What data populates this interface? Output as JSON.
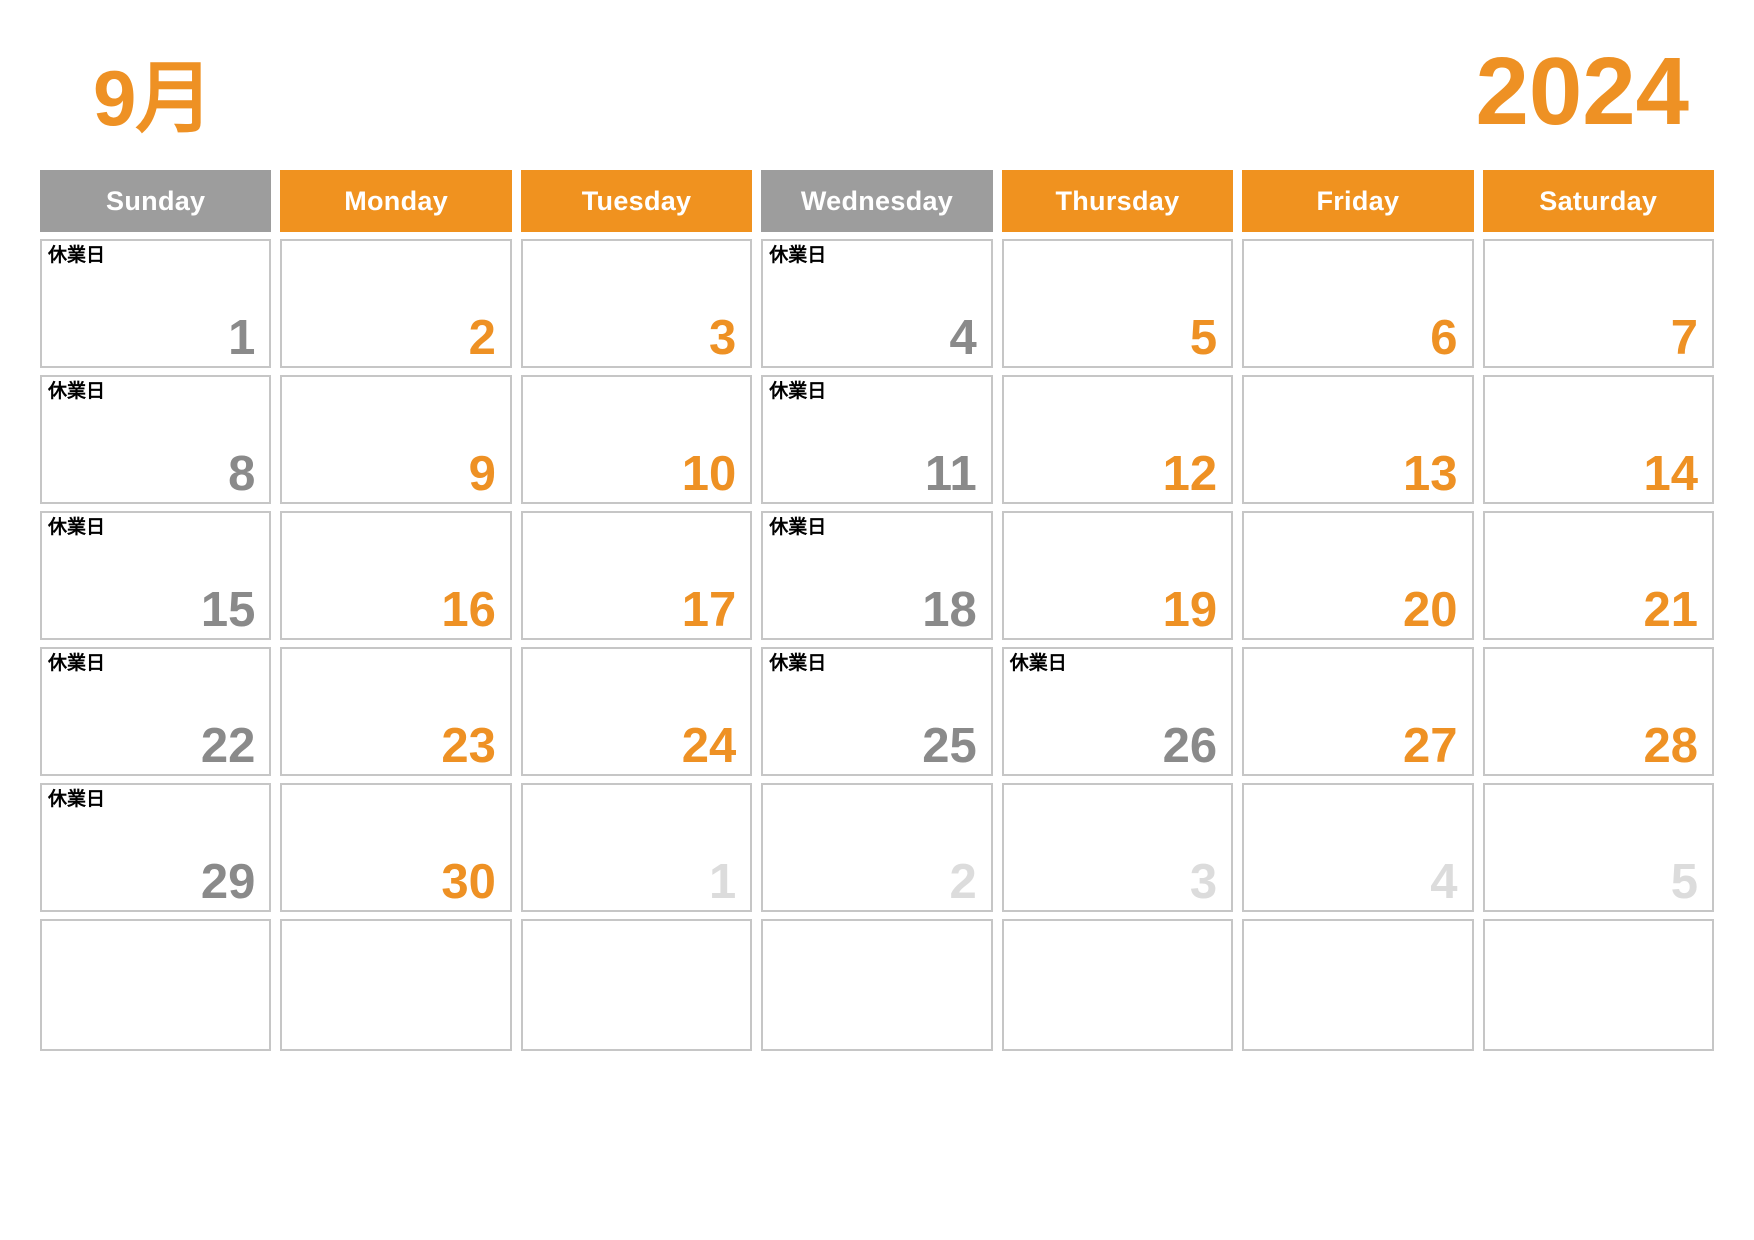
{
  "header": {
    "month_label": "9月",
    "year_label": "2024"
  },
  "colors": {
    "accent_orange": "#ee9124",
    "header_orange": "#f0921f",
    "header_gray": "#9d9d9d",
    "day_gray": "#8a8a8a",
    "muted_gray": "#dcdcdc",
    "cell_border": "#c6c6c6",
    "note_black": "#000000"
  },
  "weekday_headers": [
    {
      "label": "Sunday",
      "style": "gray"
    },
    {
      "label": "Monday",
      "style": "orange"
    },
    {
      "label": "Tuesday",
      "style": "orange"
    },
    {
      "label": "Wednesday",
      "style": "gray"
    },
    {
      "label": "Thursday",
      "style": "orange"
    },
    {
      "label": "Friday",
      "style": "orange"
    },
    {
      "label": "Saturday",
      "style": "orange"
    }
  ],
  "closed_note": "休業日",
  "weeks": [
    [
      {
        "day": "1",
        "style": "gray",
        "note": "休業日"
      },
      {
        "day": "2",
        "style": "orange",
        "note": ""
      },
      {
        "day": "3",
        "style": "orange",
        "note": ""
      },
      {
        "day": "4",
        "style": "gray",
        "note": "休業日"
      },
      {
        "day": "5",
        "style": "orange",
        "note": ""
      },
      {
        "day": "6",
        "style": "orange",
        "note": ""
      },
      {
        "day": "7",
        "style": "orange",
        "note": ""
      }
    ],
    [
      {
        "day": "8",
        "style": "gray",
        "note": "休業日"
      },
      {
        "day": "9",
        "style": "orange",
        "note": ""
      },
      {
        "day": "10",
        "style": "orange",
        "note": ""
      },
      {
        "day": "11",
        "style": "gray",
        "note": "休業日"
      },
      {
        "day": "12",
        "style": "orange",
        "note": ""
      },
      {
        "day": "13",
        "style": "orange",
        "note": ""
      },
      {
        "day": "14",
        "style": "orange",
        "note": ""
      }
    ],
    [
      {
        "day": "15",
        "style": "gray",
        "note": "休業日"
      },
      {
        "day": "16",
        "style": "orange",
        "note": ""
      },
      {
        "day": "17",
        "style": "orange",
        "note": ""
      },
      {
        "day": "18",
        "style": "gray",
        "note": "休業日"
      },
      {
        "day": "19",
        "style": "orange",
        "note": ""
      },
      {
        "day": "20",
        "style": "orange",
        "note": ""
      },
      {
        "day": "21",
        "style": "orange",
        "note": ""
      }
    ],
    [
      {
        "day": "22",
        "style": "gray",
        "note": "休業日"
      },
      {
        "day": "23",
        "style": "orange",
        "note": ""
      },
      {
        "day": "24",
        "style": "orange",
        "note": ""
      },
      {
        "day": "25",
        "style": "gray",
        "note": "休業日"
      },
      {
        "day": "26",
        "style": "gray",
        "note": "休業日"
      },
      {
        "day": "27",
        "style": "orange",
        "note": ""
      },
      {
        "day": "28",
        "style": "orange",
        "note": ""
      }
    ],
    [
      {
        "day": "29",
        "style": "gray",
        "note": "休業日"
      },
      {
        "day": "30",
        "style": "orange",
        "note": ""
      },
      {
        "day": "1",
        "style": "muted",
        "note": ""
      },
      {
        "day": "2",
        "style": "muted",
        "note": ""
      },
      {
        "day": "3",
        "style": "muted",
        "note": ""
      },
      {
        "day": "4",
        "style": "muted",
        "note": ""
      },
      {
        "day": "5",
        "style": "muted",
        "note": ""
      }
    ],
    [
      {
        "day": "",
        "style": "muted",
        "note": ""
      },
      {
        "day": "",
        "style": "muted",
        "note": ""
      },
      {
        "day": "",
        "style": "muted",
        "note": ""
      },
      {
        "day": "",
        "style": "muted",
        "note": ""
      },
      {
        "day": "",
        "style": "muted",
        "note": ""
      },
      {
        "day": "",
        "style": "muted",
        "note": ""
      },
      {
        "day": "",
        "style": "muted",
        "note": ""
      }
    ]
  ]
}
